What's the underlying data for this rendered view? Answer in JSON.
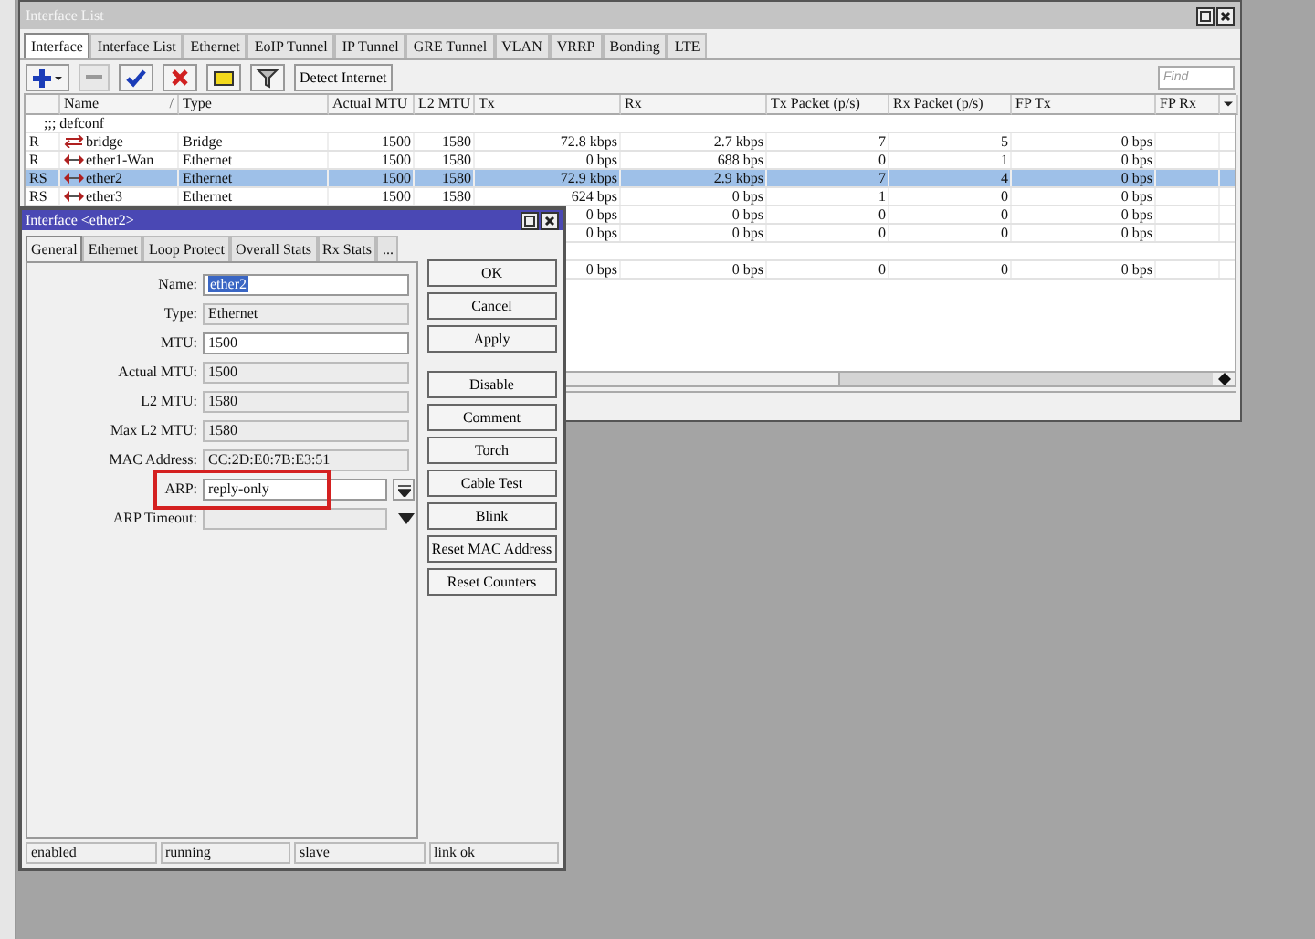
{
  "list_window": {
    "title": "Interface List",
    "tabs": [
      {
        "label": "Interface",
        "selected": true
      },
      {
        "label": "Interface List",
        "selected": false
      },
      {
        "label": "Ethernet",
        "selected": false
      },
      {
        "label": "EoIP Tunnel",
        "selected": false
      },
      {
        "label": "IP Tunnel",
        "selected": false
      },
      {
        "label": "GRE Tunnel",
        "selected": false
      },
      {
        "label": "VLAN",
        "selected": false
      },
      {
        "label": "VRRP",
        "selected": false
      },
      {
        "label": "Bonding",
        "selected": false
      },
      {
        "label": "LTE",
        "selected": false
      }
    ],
    "toolbar": [
      {
        "kind": "add",
        "disabled": false
      },
      {
        "kind": "remove",
        "disabled": true
      },
      {
        "kind": "enable",
        "disabled": false
      },
      {
        "kind": "disable",
        "disabled": false
      },
      {
        "kind": "comment",
        "disabled": false
      },
      {
        "kind": "filter",
        "disabled": false
      },
      {
        "kind": "text",
        "label": "Detect Internet",
        "disabled": false
      }
    ],
    "find": {
      "placeholder": "Find"
    },
    "columns": [
      {},
      {
        "label": "Name",
        "sort_mark": "/"
      },
      {
        "label": "Type"
      },
      {
        "label": "Actual MTU"
      },
      {
        "label": "L2 MTU"
      },
      {
        "label": "Tx"
      },
      {
        "label": "Rx"
      },
      {
        "label": "Tx Packet (p/s)"
      },
      {
        "label": "Rx Packet (p/s)"
      },
      {
        "label": "FP Tx"
      },
      {
        "label": "FP Rx"
      }
    ],
    "rows": [
      {
        "kind": "comment",
        "text": ";;; defconf",
        "selected": false
      },
      {
        "kind": "bridge",
        "selected": false,
        "flags": "R",
        "name": "bridge",
        "type": "Bridge",
        "actual_mtu": "1500",
        "l2_mtu": "1580",
        "tx": "72.8 kbps",
        "rx": "2.7 kbps",
        "tx_packet": "7",
        "rx_packet": "5",
        "fp_tx": "0 bps"
      },
      {
        "kind": "ethernet",
        "selected": false,
        "flags": "R",
        "name": "ether1-Wan",
        "type": "Ethernet",
        "actual_mtu": "1500",
        "l2_mtu": "1580",
        "tx": "0 bps",
        "rx": "688 bps",
        "tx_packet": "0",
        "rx_packet": "1",
        "fp_tx": "0 bps"
      },
      {
        "kind": "ethernet",
        "selected": true,
        "flags": "RS",
        "name": "ether2",
        "type": "Ethernet",
        "actual_mtu": "1500",
        "l2_mtu": "1580",
        "tx": "72.9 kbps",
        "rx": "2.9 kbps",
        "tx_packet": "7",
        "rx_packet": "4",
        "fp_tx": "0 bps"
      },
      {
        "kind": "ethernet",
        "selected": false,
        "flags": "RS",
        "name": "ether3",
        "type": "Ethernet",
        "actual_mtu": "1500",
        "l2_mtu": "1580",
        "tx": "624 bps",
        "rx": "0 bps",
        "tx_packet": "1",
        "rx_packet": "0",
        "fp_tx": "0 bps"
      },
      {
        "kind": "hidden",
        "selected": false,
        "tx": "0 bps",
        "rx": "0 bps",
        "tx_packet": "0",
        "rx_packet": "0",
        "fp_tx": "0 bps"
      },
      {
        "kind": "hidden",
        "selected": false,
        "tx": "0 bps",
        "rx": "0 bps",
        "tx_packet": "0",
        "rx_packet": "0",
        "fp_tx": "0 bps"
      },
      {
        "kind": "comment",
        "selected": false
      },
      {
        "kind": "hidden",
        "selected": false,
        "tx": "0 bps",
        "rx": "0 bps",
        "tx_packet": "0",
        "rx_packet": "0",
        "fp_tx": "0 bps"
      }
    ]
  },
  "dialog": {
    "title": "Interface <ether2>",
    "tabs": [
      {
        "label": "General",
        "selected": true
      },
      {
        "label": "Ethernet",
        "selected": false
      },
      {
        "label": "Loop Protect",
        "selected": false
      },
      {
        "label": "Overall Stats",
        "selected": false
      },
      {
        "label": "Rx Stats",
        "selected": false
      },
      {
        "label": "...",
        "selected": false
      }
    ],
    "fields": [
      {
        "label": "Name:",
        "kind": "text",
        "value": "ether2",
        "value_highlighted": true,
        "highlighted": false
      },
      {
        "label": "Type:",
        "kind": "readonly",
        "value": "Ethernet",
        "value_highlighted": false,
        "highlighted": false
      },
      {
        "label": "MTU:",
        "kind": "text",
        "value": "1500",
        "value_highlighted": false,
        "highlighted": false
      },
      {
        "label": "Actual MTU:",
        "kind": "readonly",
        "value": "1500",
        "value_highlighted": false,
        "highlighted": false
      },
      {
        "label": "L2 MTU:",
        "kind": "readonly",
        "value": "1580",
        "value_highlighted": false,
        "highlighted": false
      },
      {
        "label": "Max L2 MTU:",
        "kind": "readonly",
        "value": "1580",
        "value_highlighted": false,
        "highlighted": false
      },
      {
        "label": "MAC Address:",
        "kind": "readonly",
        "value": "CC:2D:E0:7B:E3:51",
        "value_highlighted": false,
        "highlighted": false
      },
      {
        "label": "ARP:",
        "kind": "dropdown",
        "value": "reply-only",
        "value_highlighted": false,
        "highlighted": true
      },
      {
        "label": "ARP Timeout:",
        "kind": "combo",
        "highlighted": false
      }
    ],
    "buttons": [
      "OK",
      "Cancel",
      "Apply",
      "Disable",
      "Comment",
      "Torch",
      "Cable Test",
      "Blink",
      "Reset MAC Address",
      "Reset Counters"
    ],
    "status_bar": [
      "enabled",
      "running",
      "slave",
      "link ok"
    ]
  }
}
